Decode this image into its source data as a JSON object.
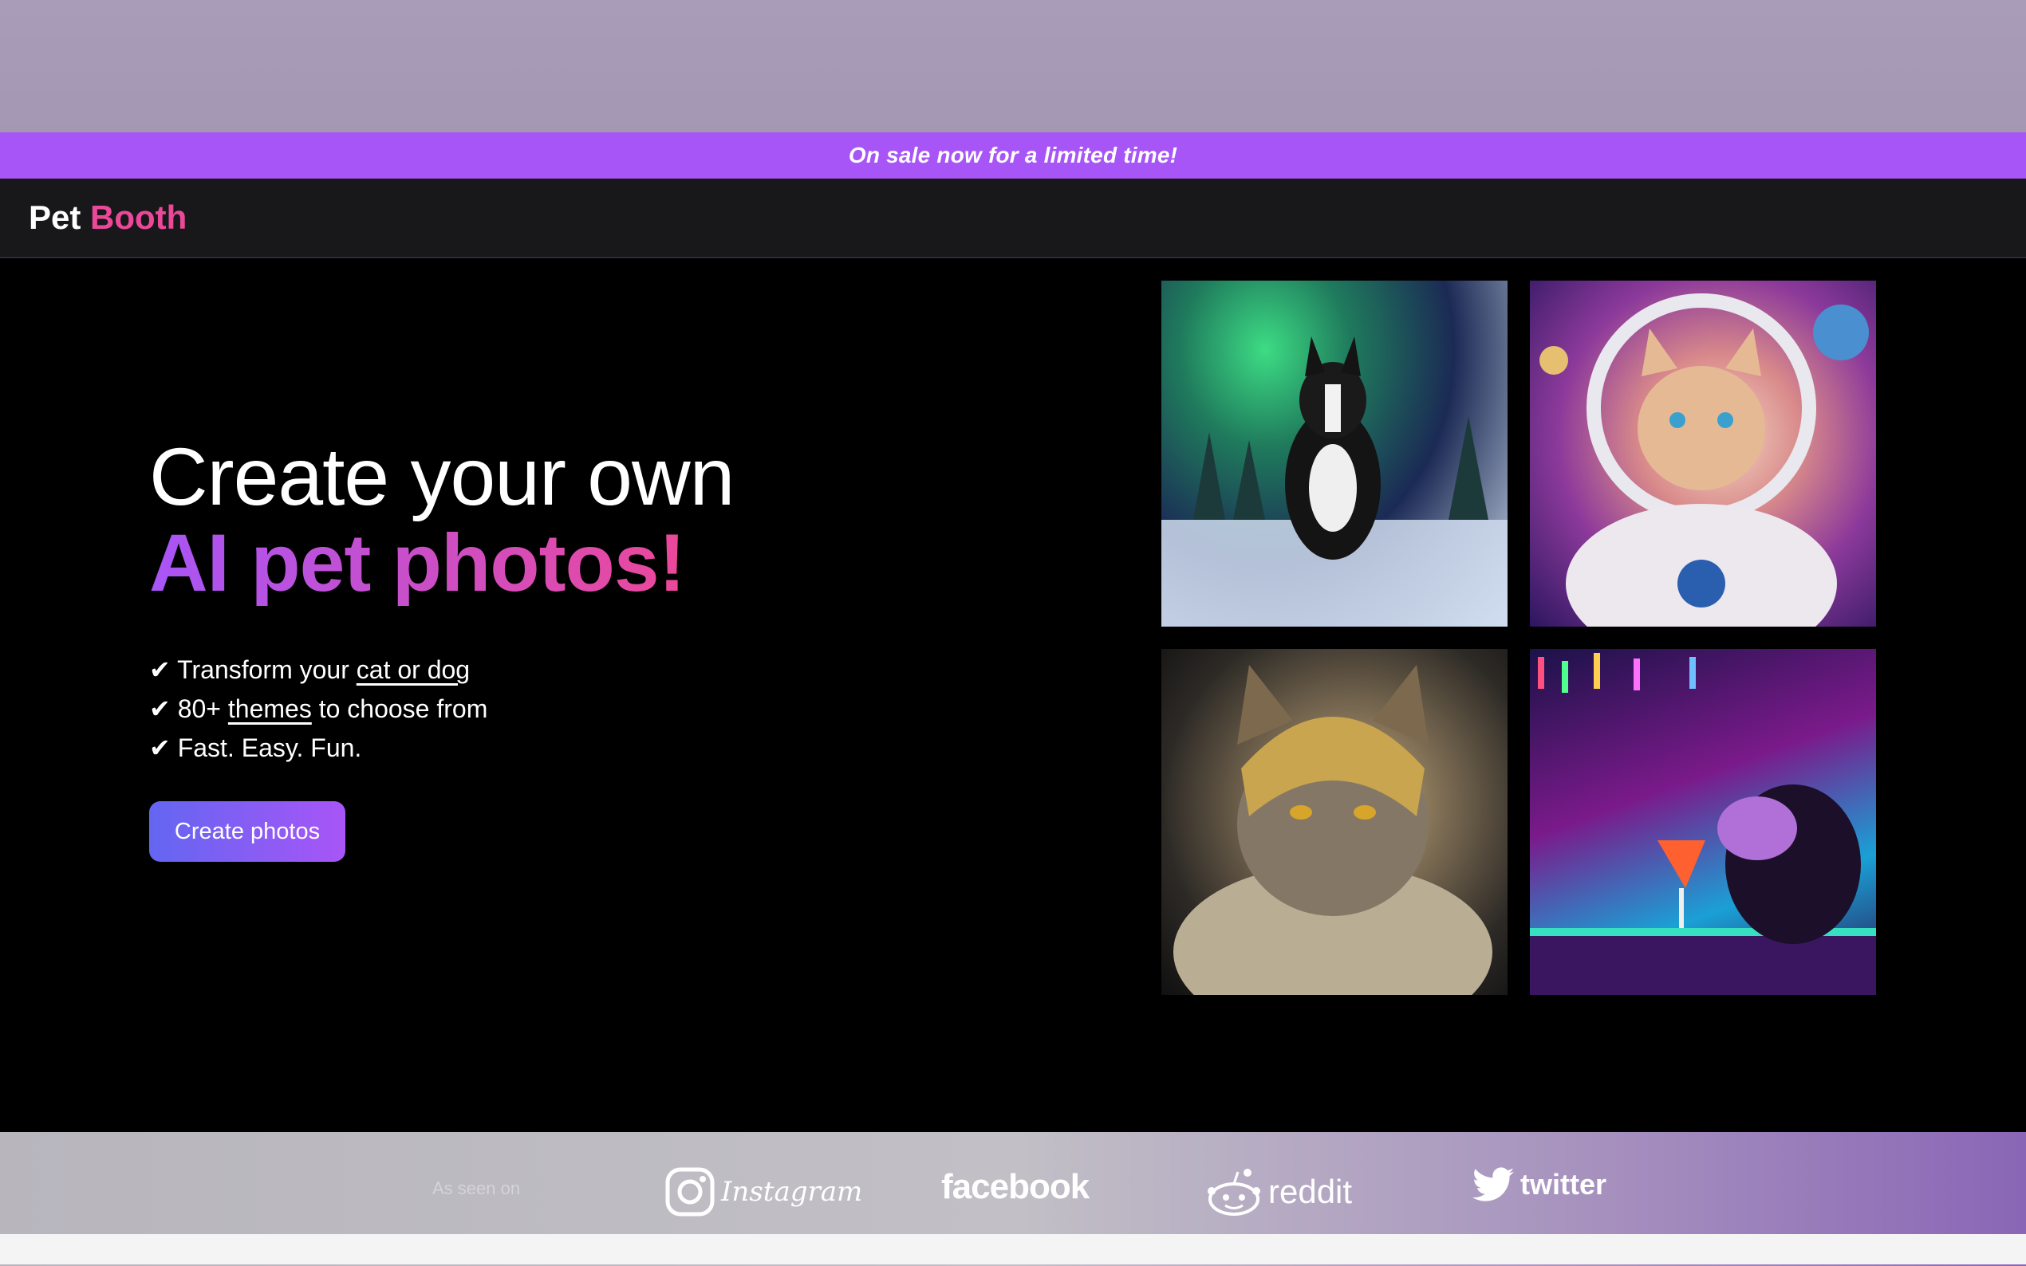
{
  "banner": {
    "text": "On sale now for a limited time!"
  },
  "header": {
    "logo_part1": "Pet",
    "logo_part2": "Booth"
  },
  "hero": {
    "title_line1": "Create your own",
    "title_line2": "AI pet photos!",
    "features": [
      {
        "check": "✔",
        "prefix": "Transform your ",
        "link": "cat or dog",
        "suffix": ""
      },
      {
        "check": "✔",
        "prefix": "80+ ",
        "link": "themes",
        "suffix": " to choose from"
      },
      {
        "check": "✔",
        "prefix": "Fast. Easy. Fun.",
        "link": "",
        "suffix": ""
      }
    ],
    "cta_label": "Create photos"
  },
  "gallery": {
    "images": [
      {
        "icon": "aurora-dog-photo"
      },
      {
        "icon": "astronaut-cat-photo"
      },
      {
        "icon": "knight-cat-photo"
      },
      {
        "icon": "bar-dog-photo"
      }
    ]
  },
  "seen_on": {
    "label": "As seen on",
    "brands": [
      "Instagram",
      "facebook",
      "reddit",
      "twitter"
    ]
  },
  "colors": {
    "banner_bg": "#a855f7",
    "accent_pink": "#ec4899",
    "accent_purple": "#a855f7",
    "cta_gradient_start": "#6366f1"
  }
}
